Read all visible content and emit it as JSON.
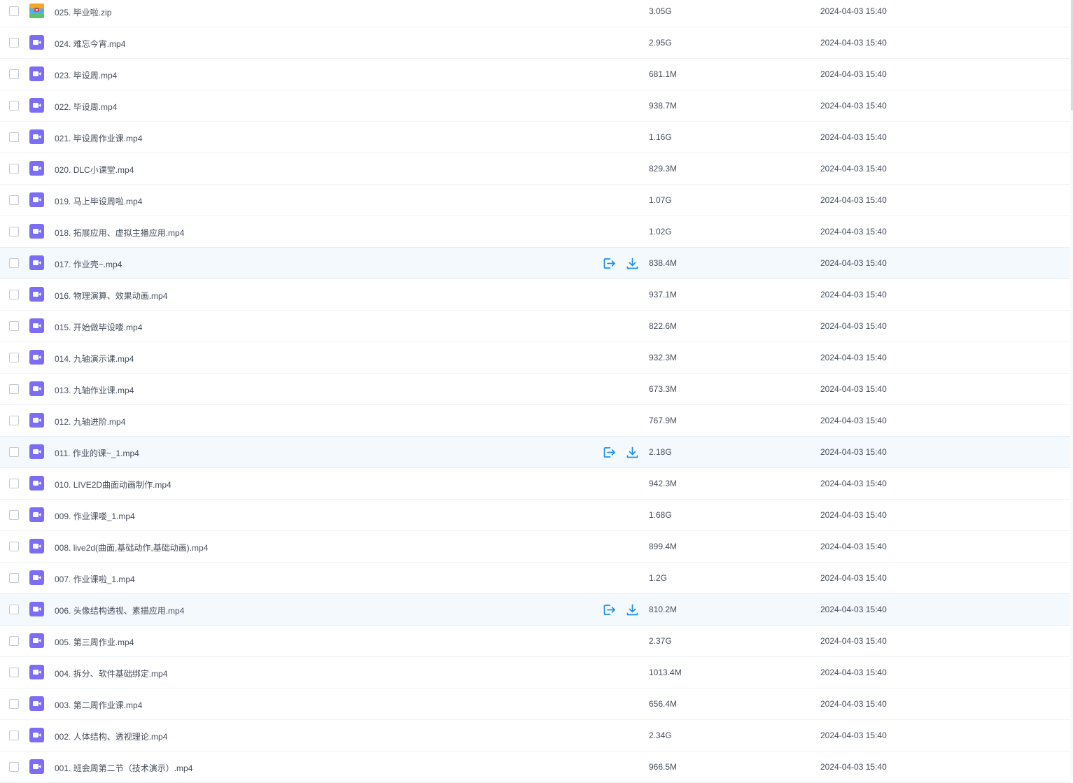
{
  "colors": {
    "video_icon": "#7b6ef5",
    "action_icon": "#1e90e8",
    "row_hover_bg": "#f4f9fd",
    "text": "#454d5a"
  },
  "icons": {
    "video": "video-file-icon",
    "zip": "zip-file-icon",
    "share": "share-icon",
    "download": "download-icon"
  },
  "files": [
    {
      "name": "025. 毕业啦.zip",
      "size": "3.05G",
      "date": "2024-04-03 15:40",
      "type": "zip",
      "hover": false
    },
    {
      "name": "024. 难忘今宵.mp4",
      "size": "2.95G",
      "date": "2024-04-03 15:40",
      "type": "video",
      "hover": false
    },
    {
      "name": "023. 毕设周.mp4",
      "size": "681.1M",
      "date": "2024-04-03 15:40",
      "type": "video",
      "hover": false
    },
    {
      "name": "022. 毕设周.mp4",
      "size": "938.7M",
      "date": "2024-04-03 15:40",
      "type": "video",
      "hover": false
    },
    {
      "name": "021. 毕设周作业课.mp4",
      "size": "1.16G",
      "date": "2024-04-03 15:40",
      "type": "video",
      "hover": false
    },
    {
      "name": "020. DLC小课堂.mp4",
      "size": "829.3M",
      "date": "2024-04-03 15:40",
      "type": "video",
      "hover": false
    },
    {
      "name": "019. 马上毕设周啦.mp4",
      "size": "1.07G",
      "date": "2024-04-03 15:40",
      "type": "video",
      "hover": false
    },
    {
      "name": "018. 拓展应用、虚拟主播应用.mp4",
      "size": "1.02G",
      "date": "2024-04-03 15:40",
      "type": "video",
      "hover": false
    },
    {
      "name": "017. 作业壳~.mp4",
      "size": "838.4M",
      "date": "2024-04-03 15:40",
      "type": "video",
      "hover": true
    },
    {
      "name": "016. 物理演算、效果动画.mp4",
      "size": "937.1M",
      "date": "2024-04-03 15:40",
      "type": "video",
      "hover": false
    },
    {
      "name": "015. 开始做毕设喽.mp4",
      "size": "822.6M",
      "date": "2024-04-03 15:40",
      "type": "video",
      "hover": false
    },
    {
      "name": "014. 九轴演示课.mp4",
      "size": "932.3M",
      "date": "2024-04-03 15:40",
      "type": "video",
      "hover": false
    },
    {
      "name": "013. 九轴作业课.mp4",
      "size": "673.3M",
      "date": "2024-04-03 15:40",
      "type": "video",
      "hover": false
    },
    {
      "name": "012. 九轴进阶.mp4",
      "size": "767.9M",
      "date": "2024-04-03 15:40",
      "type": "video",
      "hover": false
    },
    {
      "name": "011. 作业的课~_1.mp4",
      "size": "2.18G",
      "date": "2024-04-03 15:40",
      "type": "video",
      "hover": true
    },
    {
      "name": "010. LIVE2D曲面动画制作.mp4",
      "size": "942.3M",
      "date": "2024-04-03 15:40",
      "type": "video",
      "hover": false
    },
    {
      "name": "009. 作业课喽_1.mp4",
      "size": "1.68G",
      "date": "2024-04-03 15:40",
      "type": "video",
      "hover": false
    },
    {
      "name": "008. live2d(曲面,基础动作,基础动画).mp4",
      "size": "899.4M",
      "date": "2024-04-03 15:40",
      "type": "video",
      "hover": false
    },
    {
      "name": "007. 作业课啦_1.mp4",
      "size": "1.2G",
      "date": "2024-04-03 15:40",
      "type": "video",
      "hover": false
    },
    {
      "name": "006. 头像结构透视、素描应用.mp4",
      "size": "810.2M",
      "date": "2024-04-03 15:40",
      "type": "video",
      "hover": true
    },
    {
      "name": "005. 第三周作业.mp4",
      "size": "2.37G",
      "date": "2024-04-03 15:40",
      "type": "video",
      "hover": false
    },
    {
      "name": "004. 拆分、软件基础绑定.mp4",
      "size": "1013.4M",
      "date": "2024-04-03 15:40",
      "type": "video",
      "hover": false
    },
    {
      "name": "003. 第二周作业课.mp4",
      "size": "656.4M",
      "date": "2024-04-03 15:40",
      "type": "video",
      "hover": false
    },
    {
      "name": "002. 人体结构、透视理论.mp4",
      "size": "2.34G",
      "date": "2024-04-03 15:40",
      "type": "video",
      "hover": false
    },
    {
      "name": "001. 班会周第二节（技术演示）.mp4",
      "size": "966.5M",
      "date": "2024-04-03 15:40",
      "type": "video",
      "hover": false
    }
  ]
}
